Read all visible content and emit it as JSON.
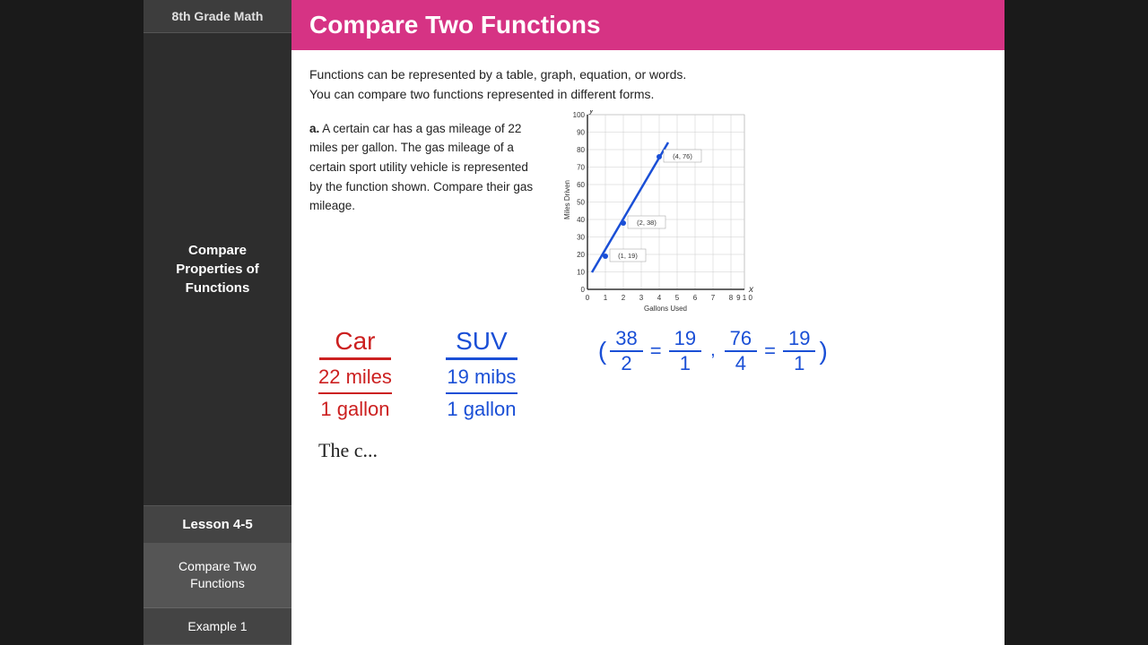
{
  "sidebar": {
    "grade_label": "8th Grade Math",
    "section_title": "Compare Properties of Functions",
    "lesson_label": "Lesson 4-5",
    "topic_label": "Compare Two Functions",
    "example_label": "Example 1"
  },
  "header": {
    "title": "Compare Two Functions"
  },
  "intro": {
    "line1": "Functions can be represented by a table, graph, equation, or words.",
    "line2": "You can compare two functions represented in different forms."
  },
  "problem": {
    "label": "a.",
    "text": "A certain car has a gas mileage of 22 miles per gallon. The gas mileage of a certain sport utility vehicle is represented by the function shown. Compare their gas mileage."
  },
  "graph": {
    "title_y": "y",
    "title_x": "x",
    "y_label": "Miles Driven",
    "x_label": "Gallons Used",
    "y_max": 100,
    "points": [
      {
        "x": 1,
        "y": 19,
        "label": "(1, 19)"
      },
      {
        "x": 2,
        "y": 38,
        "label": "(2, 38)"
      },
      {
        "x": 4,
        "y": 76,
        "label": "(4, 76)"
      }
    ]
  },
  "handwritten": {
    "car_label": "Car",
    "suv_label": "SUV",
    "car_rate_num": "22 miles",
    "car_rate_den": "1 gallon",
    "suv_rate_num": "19 mibs",
    "suv_rate_den": "1 gallon",
    "fraction_display": "(38/2 = 19/1, 76/4 = 19/1)"
  },
  "conclusion": {
    "text": "The c..."
  }
}
